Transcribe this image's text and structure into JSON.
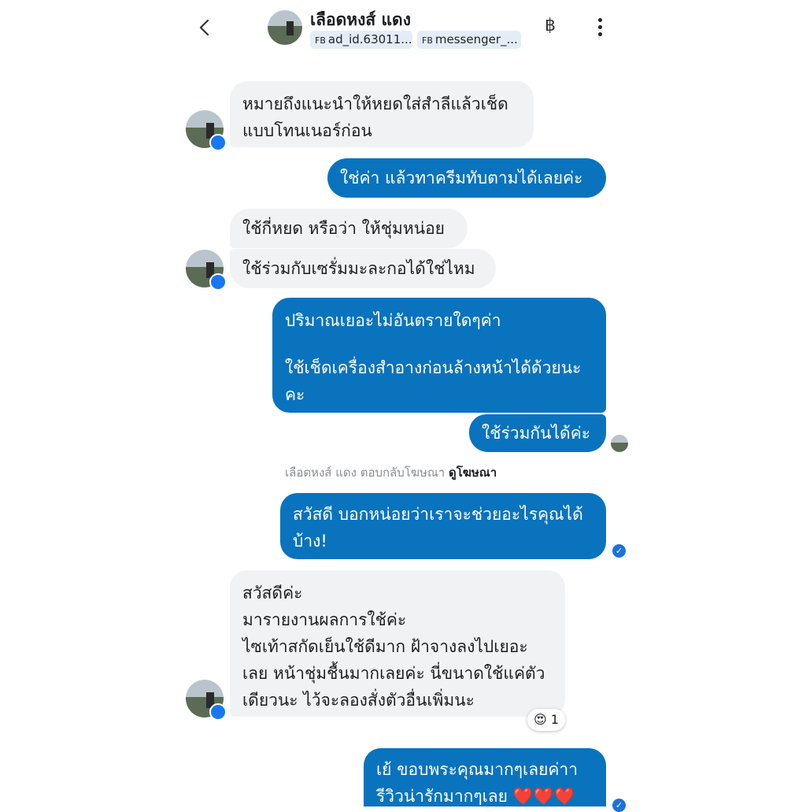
{
  "header": {
    "contact_name": "เลือดหงส์ แดง",
    "chips": [
      {
        "prefix": "FB",
        "label": "ad_id.63011..."
      },
      {
        "prefix": "FB",
        "label": "messenger_..."
      }
    ],
    "currency_symbol": "฿",
    "icons": {
      "back": "chevron-left-icon",
      "menu": "more-vertical-icon"
    }
  },
  "messages": [
    {
      "dir": "in",
      "lines": [
        "หมายถึงแนะนำให้หยดใส่สำลีแล้วเช็ด",
        "แบบโทนเนอร์ก่อน"
      ]
    },
    {
      "dir": "out",
      "lines": [
        "ใช่ค่า แล้วทาครีมทับตามได้เลยค่ะ"
      ]
    },
    {
      "dir": "in",
      "lines": [
        "ใช้กี่หยด หรือว่า ให้ชุ่มหน่อย"
      ]
    },
    {
      "dir": "in",
      "lines": [
        "ใช้ร่วมกับเซรั่มมะละกอได้ใช่ไหม"
      ]
    },
    {
      "dir": "out",
      "lines": [
        "ปริมาณเยอะไม่อันตรายใดๆค่า",
        "",
        "ใช้เช็ดเครื่องสำอางก่อนล้างหน้าได้ด้วยนะ",
        "คะ"
      ]
    },
    {
      "dir": "out",
      "lines": [
        "ใช้ร่วมกันได้ค่ะ"
      ]
    },
    {
      "dir": "out",
      "lines": [
        "สวัสดี บอกหน่อยว่าเราจะช่วยอะไรคุณได้",
        "บ้าง!"
      ]
    },
    {
      "dir": "in",
      "lines": [
        "สวัสดีค่ะ",
        "มารายงานผลการใช้ค่ะ",
        "ไซเท้าสกัดเย็นใช้ดีมาก ฝ้าจางลงไปเยอะ",
        "เลย หน้าชุ่มชื้นมากเลยค่ะ นี่ขนาดใช้แค่ตัว",
        "เดียวนะ ไว้จะลองสั่งตัวอื่นเพิ่มนะ"
      ]
    },
    {
      "dir": "out",
      "lines": [
        "เย้ ขอบพระคุณมากๆเลยค่าา",
        "รีวิวน่ารักมากๆเลย ❤️❤️❤️"
      ]
    }
  ],
  "ad_notice": {
    "text": "เลือดหงส์ แดง ตอบกลับโฆษณา",
    "link": "ดูโฆษณา"
  },
  "reaction": {
    "emoji": "😍",
    "count": "1"
  },
  "colors": {
    "outgoing_bubble": "#0a73be",
    "incoming_bubble": "#f1f2f4",
    "messenger_badge": "#1877f2"
  }
}
